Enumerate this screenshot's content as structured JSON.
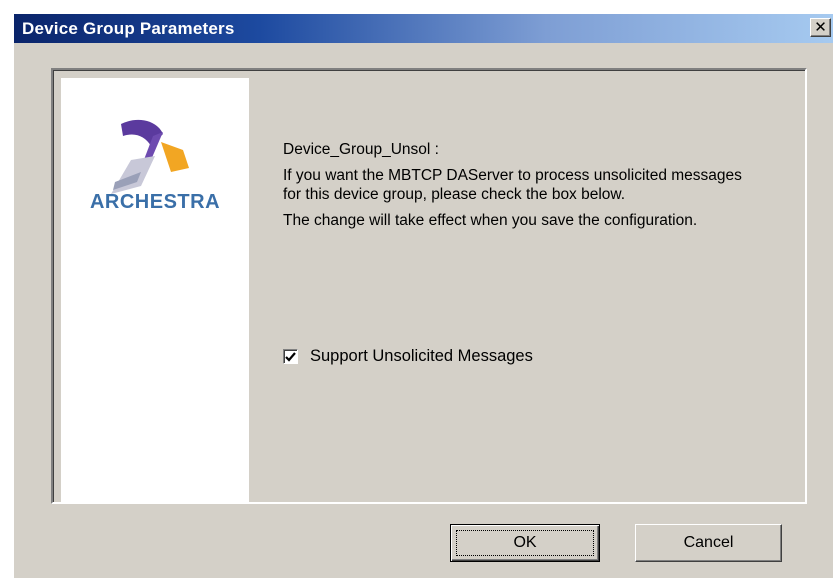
{
  "window": {
    "title": "Device Group Parameters",
    "close_glyph": "✕"
  },
  "logo": {
    "text": "ARCHESTRA",
    "colors": {
      "purple": "#5b3a9e",
      "orange": "#f2a623",
      "text": "#3a6fa8"
    }
  },
  "content": {
    "heading": "Device_Group_Unsol :",
    "paragraph1": "If you want the MBTCP DAServer to process unsolicited messages for this device group, please check the box below.",
    "paragraph2": "The change will take effect when you save the configuration."
  },
  "checkbox": {
    "label": "Support Unsolicited Messages",
    "checked": true
  },
  "buttons": {
    "ok_label": "OK",
    "cancel_label": "Cancel"
  }
}
